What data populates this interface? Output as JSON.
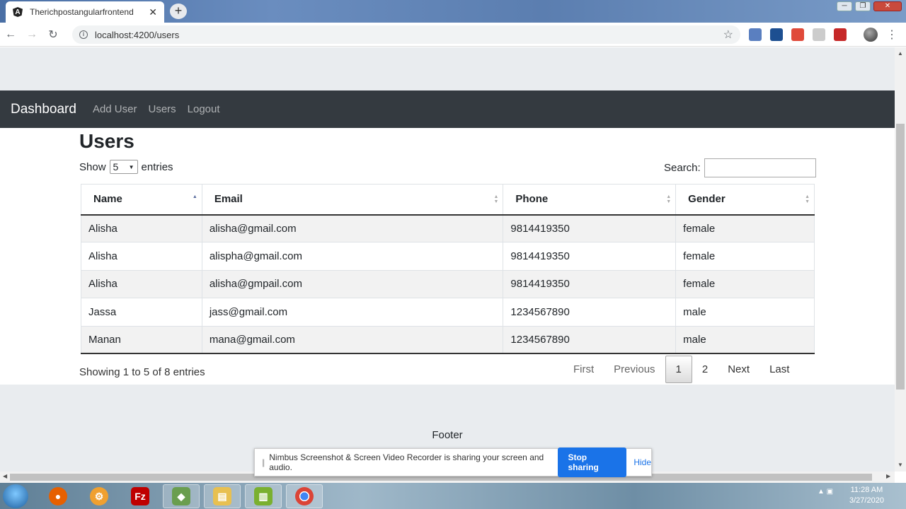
{
  "browser": {
    "tab_title": "Therichpostangularfrontend",
    "tab_close": "✕",
    "new_tab": "+",
    "url": "localhost:4200/users",
    "win_min": "─",
    "win_max": "❐",
    "win_close": "✕"
  },
  "navbar": {
    "brand": "Dashboard",
    "links": [
      "Add User",
      "Users",
      "Logout"
    ]
  },
  "page": {
    "title": "Users",
    "show_label": "Show",
    "entries_label": "entries",
    "page_length": "5",
    "search_label": "Search:",
    "search_value": ""
  },
  "table": {
    "columns": [
      "Name",
      "Email",
      "Phone",
      "Gender"
    ],
    "sorted_column": "Name",
    "rows": [
      [
        "Alisha",
        "alisha@gmail.com",
        "9814419350",
        "female"
      ],
      [
        "Alisha",
        "alispha@gmail.com",
        "9814419350",
        "female"
      ],
      [
        "Alisha",
        "alisha@gmpail.com",
        "9814419350",
        "female"
      ],
      [
        "Jassa",
        "jass@gmail.com",
        "1234567890",
        "male"
      ],
      [
        "Manan",
        "mana@gmail.com",
        "1234567890",
        "male"
      ]
    ]
  },
  "info": "Showing 1 to 5 of 8 entries",
  "pagination": {
    "first": "First",
    "previous": "Previous",
    "pages": [
      "1",
      "2"
    ],
    "current": "1",
    "next": "Next",
    "last": "Last"
  },
  "footer": "Footer",
  "share_bar": {
    "message": "Nimbus Screenshot & Screen Video Recorder is sharing your screen and audio.",
    "stop": "Stop sharing",
    "hide": "Hide"
  },
  "taskbar": {
    "time": "11:28 AM",
    "date": "3/27/2020"
  },
  "colors": {
    "navbar": "#343a40",
    "page_bg": "#e9ecef",
    "stop_button": "#1a73e8"
  }
}
